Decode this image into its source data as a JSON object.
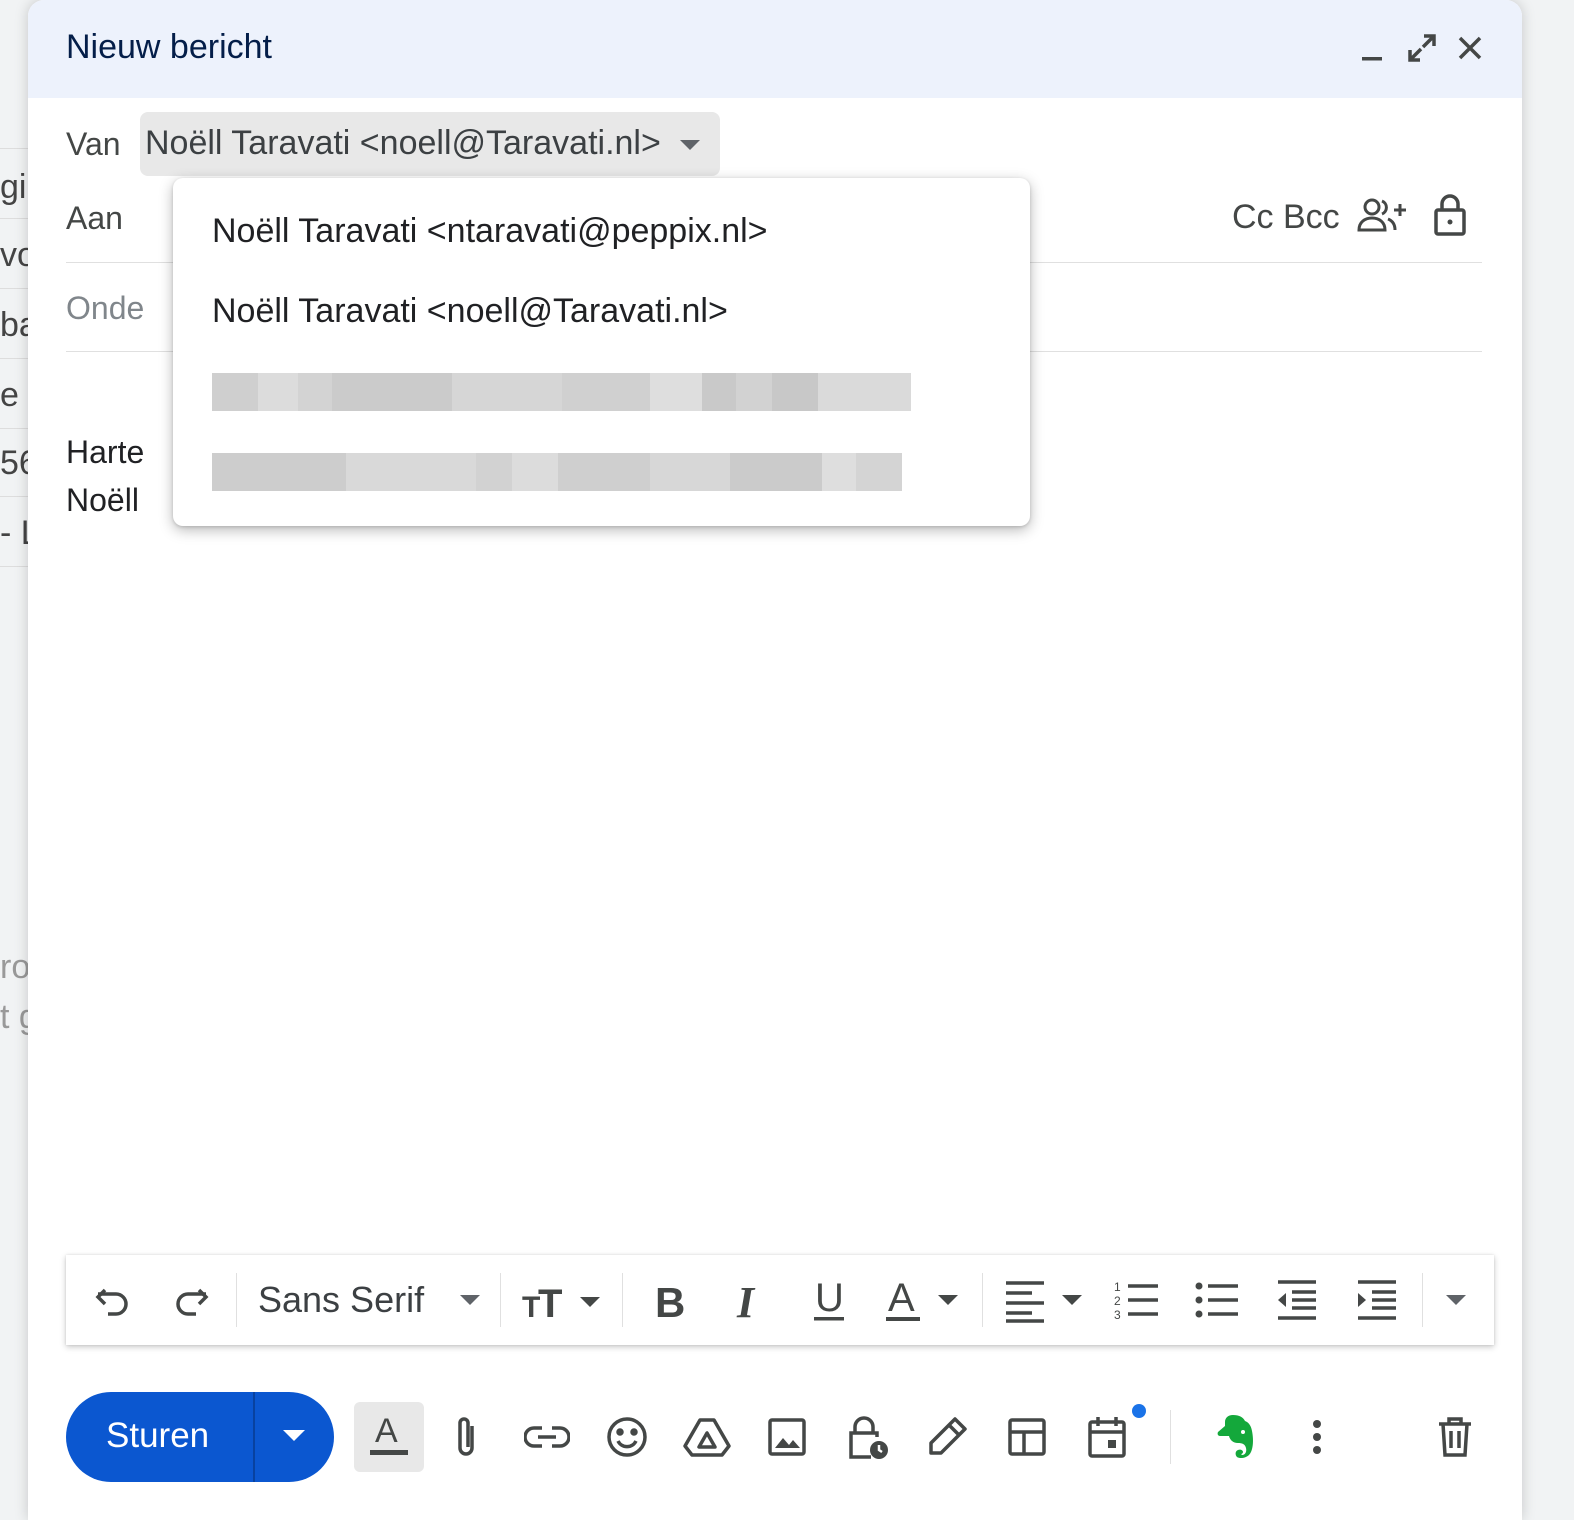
{
  "background": {
    "fragments": [
      "gi",
      "vo",
      "ba",
      "e –",
      "56",
      "- L",
      "ro",
      "t g"
    ]
  },
  "window": {
    "title": "Nieuw bericht",
    "minimize_icon": "minimize-icon",
    "expand_icon": "expand-icon",
    "close_icon": "close-icon"
  },
  "from": {
    "label": "Van",
    "value": "Noëll Taravati <noell@Taravati.nl>"
  },
  "to": {
    "label": "Aan",
    "cc_bcc": "Cc Bcc"
  },
  "subject": {
    "placeholder_partial": "Onde"
  },
  "body": {
    "line1": "Harte",
    "line2": "Noëll"
  },
  "from_menu": {
    "options": [
      "Noëll Taravati <ntaravati@peppix.nl>",
      "Noëll Taravati <noell@Taravati.nl>"
    ],
    "redacted_count": 2
  },
  "format_toolbar": {
    "font": "Sans Serif",
    "buttons": [
      "undo-icon",
      "redo-icon",
      "font-size-icon",
      "bold-icon",
      "italic-icon",
      "underline-icon",
      "text-color-icon",
      "align-icon",
      "numbered-list-icon",
      "bulleted-list-icon",
      "indent-less-icon",
      "indent-more-icon",
      "more-formatting-icon"
    ]
  },
  "actions": {
    "send_label": "Sturen",
    "buttons": [
      "formatting-icon",
      "attach-icon",
      "link-icon",
      "emoji-icon",
      "drive-icon",
      "photo-icon",
      "confidential-icon",
      "signature-icon",
      "template-icon",
      "schedule-icon",
      "evernote-icon",
      "more-options-icon",
      "delete-icon"
    ]
  },
  "colors": {
    "send": "#0b57d0",
    "header_bg": "#edf2fc",
    "title": "#041e49",
    "evernote": "#14a83b",
    "notification": "#1a73e8"
  }
}
